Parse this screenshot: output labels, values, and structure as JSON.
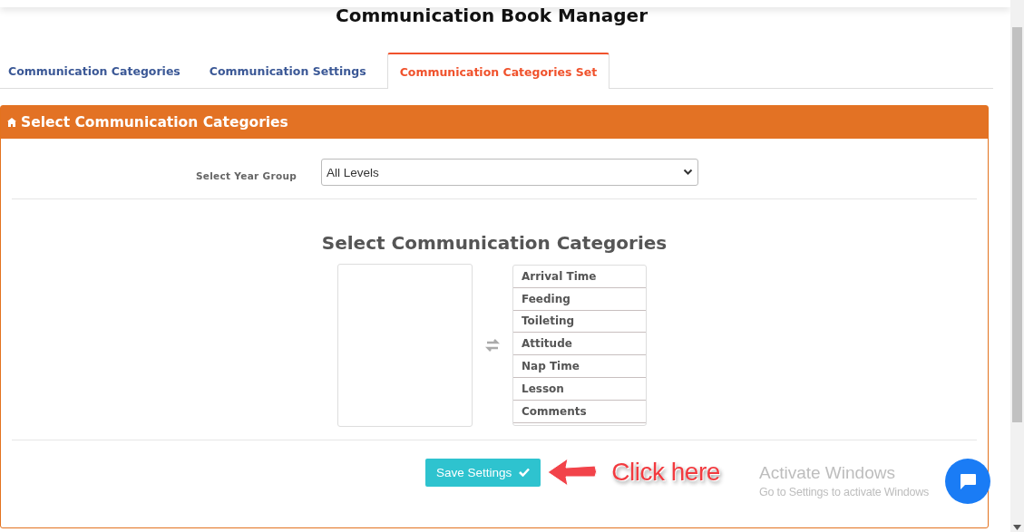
{
  "page": {
    "title": "Communication Book Manager"
  },
  "tabs": [
    {
      "label": "Communication Categories",
      "selected": false
    },
    {
      "label": "Communication Settings",
      "selected": false
    },
    {
      "label": "Communication Categories Set",
      "selected": true
    }
  ],
  "panel": {
    "title": "Select Communication Categories",
    "year_group": {
      "label": "Select Year Group",
      "value": "All Levels"
    },
    "heading": "Select Communication Categories",
    "selected_categories": [
      "Arrival Time",
      "Feeding",
      "Toileting",
      "Attitude",
      "Nap Time",
      "Lesson",
      "Comments"
    ],
    "save_button": "Save Settings"
  },
  "annotation": {
    "text": "Click here"
  },
  "os_notice": {
    "title": "Activate Windows",
    "text": "Go to Settings to activate Windows"
  }
}
